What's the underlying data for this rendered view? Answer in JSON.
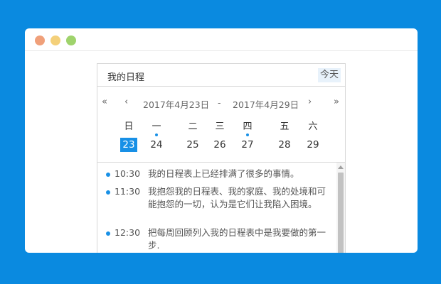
{
  "calendar": {
    "title": "我的日程",
    "today_label": "今天",
    "nav": {
      "first": "«",
      "prev": "‹",
      "next": "›",
      "last": "»"
    },
    "range_start": "2017年4月23日",
    "range_sep": "-",
    "range_end": "2017年4月29日",
    "weekdays": [
      "日",
      "一",
      "二",
      "三",
      "四",
      "五",
      "六"
    ],
    "days": [
      "23",
      "24",
      "25",
      "26",
      "27",
      "28",
      "29"
    ],
    "selected_day": "23",
    "days_with_events": [
      "24",
      "27"
    ]
  },
  "events": [
    {
      "time": "10:30",
      "text": "我的日程表上已经排满了很多的事情。"
    },
    {
      "time": "11:30",
      "text": "我抱怨我的日程表、我的家庭、我的处境和可能抱怨的一切，认为是它们让我陷入困境。"
    },
    {
      "time": "12:30",
      "text": "把每周回顾列入我的日程表中是我要做的第一步."
    }
  ],
  "colors": {
    "background": "#0a8ae0",
    "accent": "#1890e6",
    "window_close": "#f0a07a",
    "window_minimize": "#f4d07a",
    "window_maximize": "#9fd36c"
  }
}
